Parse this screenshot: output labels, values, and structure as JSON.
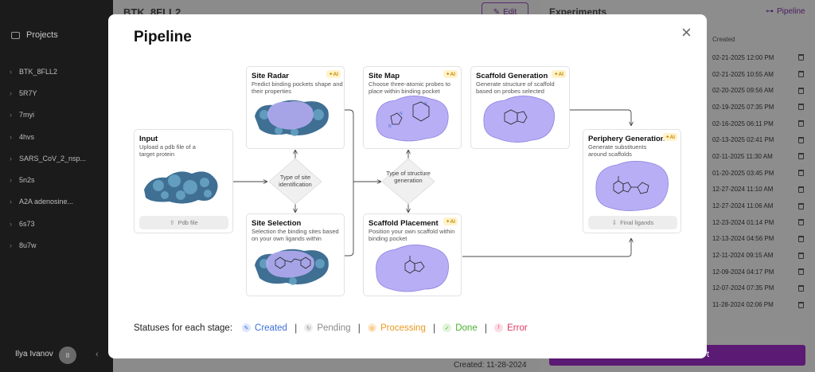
{
  "sidebar": {
    "projects_label": "Projects",
    "items": [
      "BTK_8FLL2",
      "5R7Y",
      "7myi",
      "4hvs",
      "SARS_CoV_2_nsp...",
      "5n2s",
      "A2A adenosine...",
      "6s73",
      "8u7w"
    ],
    "user_name": "Ilya Ivanov",
    "user_initials": "II"
  },
  "main": {
    "title": "BTK_8FLL2",
    "edit_label": "Edit",
    "created_text": "Created: 11-28-2024"
  },
  "experiments": {
    "title": "Experiments",
    "pipeline_link": "Pipeline",
    "column_created": "Created",
    "dates": [
      "02-21-2025 12:00 PM",
      "02-21-2025 10:55 AM",
      "02-20-2025 09:56 AM",
      "02-19-2025 07:35 PM",
      "02-16-2025 06:11 PM",
      "02-13-2025 02:41 PM",
      "02-11-2025 11:30 AM",
      "01-20-2025 03:45 PM",
      "12-27-2024 11:10 AM",
      "12-27-2024 11:06 AM",
      "12-23-2024 01:14 PM",
      "12-13-2024 04:56 PM",
      "12-11-2024 09:15 AM",
      "12-09-2024 04:17 PM",
      "12-07-2024 07:35 PM",
      "11-28-2024 02:06 PM"
    ],
    "button_tail": "t"
  },
  "modal": {
    "title": "Pipeline",
    "ai_badge": "✦AI",
    "cards": {
      "input": {
        "title": "Input",
        "desc": "Upload a pdb file of a target protein",
        "button": "Pdb file"
      },
      "site_radar": {
        "title": "Site Radar",
        "desc": "Predict binding pockets shape and their properties"
      },
      "site_selection": {
        "title": "Site Selection",
        "desc": "Selection the binding sites based on your own ligands within"
      },
      "site_map": {
        "title": "Site Map",
        "desc": "Choose three-atomic probes to place within binding pocket"
      },
      "scaffold_placement": {
        "title": "Scaffold Placement",
        "desc": "Position your own scaffold within binding pocket"
      },
      "scaffold_generation": {
        "title": "Scaffold Generation",
        "desc": "Generate structure of scaffold based on probes selected"
      },
      "periphery_generation": {
        "title": "Periphery Generation",
        "desc": "Generate substituents around scaffolds",
        "button": "Final ligands"
      }
    },
    "diamond_site": "Type of site identification",
    "diamond_structure": "Type of structure generation",
    "statuses_prefix": "Statuses for each stage:",
    "statuses": [
      {
        "label": "Created",
        "color": "#3d6fd6",
        "icon_bg": "#dde7fb",
        "icon": "✎"
      },
      {
        "label": "Pending",
        "color": "#8a8a8a",
        "icon_bg": "#ececec",
        "icon": "↻"
      },
      {
        "label": "Processing",
        "color": "#e89a22",
        "icon_bg": "#fdebcf",
        "icon": "◎"
      },
      {
        "label": "Done",
        "color": "#4caf2e",
        "icon_bg": "#e1f4d9",
        "icon": "✓"
      },
      {
        "label": "Error",
        "color": "#d93862",
        "icon_bg": "#fbdbe4",
        "icon": "!"
      }
    ]
  },
  "colors": {
    "accent": "#5b1a73",
    "pocket": "#b8aef5",
    "protein": "#3f6f93"
  }
}
